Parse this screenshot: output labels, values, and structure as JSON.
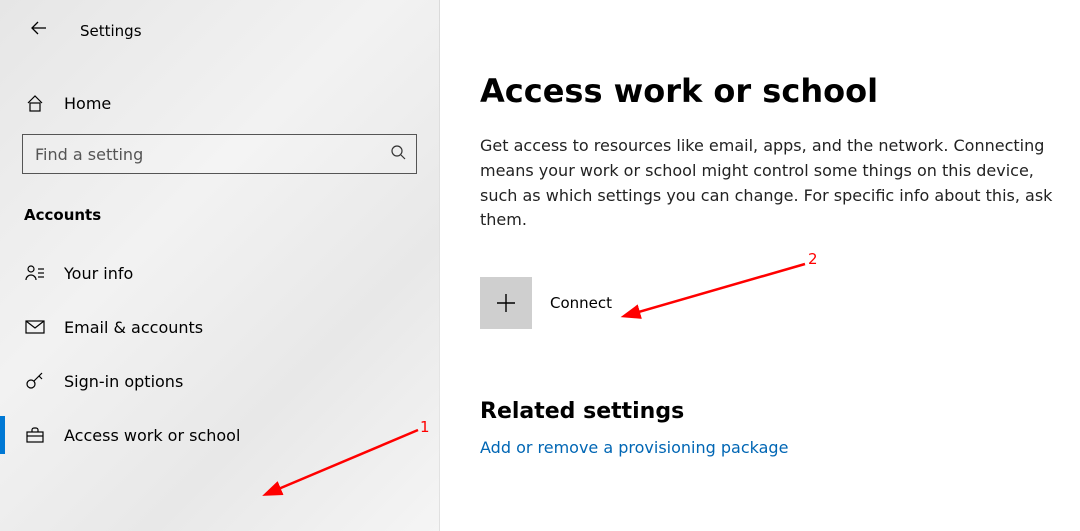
{
  "app_title": "Settings",
  "home_label": "Home",
  "search": {
    "placeholder": "Find a setting"
  },
  "category_header": "Accounts",
  "nav": {
    "your_info": "Your info",
    "email_accounts": "Email & accounts",
    "sign_in_options": "Sign-in options",
    "access_work_school": "Access work or school"
  },
  "page": {
    "heading": "Access work or school",
    "description": "Get access to resources like email, apps, and the network. Connecting means your work or school might control some things on this device, such as which settings you can change. For specific info about this, ask them.",
    "connect_label": "Connect",
    "related_heading": "Related settings",
    "provisioning_link": "Add or remove a provisioning package"
  },
  "annotations": {
    "one": "1",
    "two": "2"
  }
}
